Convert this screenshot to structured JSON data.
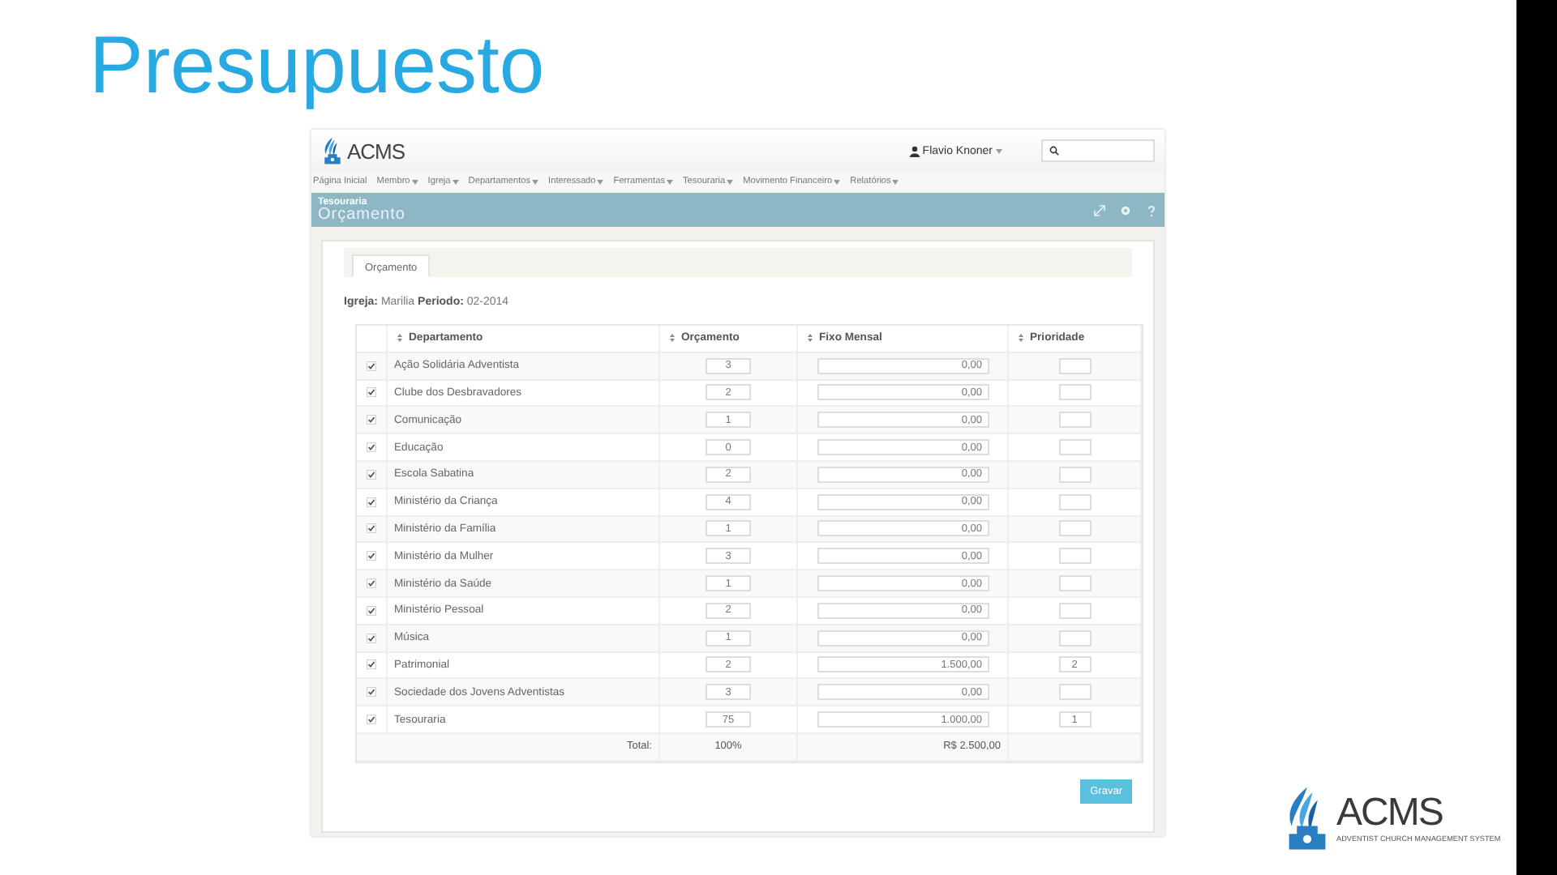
{
  "slide_title": "Presupuesto",
  "app": {
    "logo_text": "ACMS",
    "user": "Flavio Knoner",
    "nav": [
      {
        "label": "Página Inicial",
        "dropdown": false
      },
      {
        "label": "Membro",
        "dropdown": true
      },
      {
        "label": "Igreja",
        "dropdown": true
      },
      {
        "label": "Departamentos",
        "dropdown": true
      },
      {
        "label": "Interessado",
        "dropdown": true
      },
      {
        "label": "Ferramentas",
        "dropdown": true
      },
      {
        "label": "Tesouraria",
        "dropdown": true
      },
      {
        "label": "Movimento Financeiro",
        "dropdown": true
      },
      {
        "label": "Relatórios",
        "dropdown": true
      }
    ],
    "breadcrumb": "Tesouraria",
    "page_title": "Orçamento",
    "tabs": [
      {
        "label": "Orçamento",
        "selected": true
      }
    ],
    "info": "**Igreja:** Marilia   **Periodo:** 02-2014",
    "table": {
      "columns": [
        "Departamento",
        "Orçamento",
        "Fixo Mensal",
        "Prioridade"
      ],
      "rows": [
        {
          "checked": true,
          "departamento": "Ação Solidária Adventista",
          "orcamento": "3",
          "fixo": "0,00"
        },
        {
          "checked": true,
          "departamento": "Clube dos Desbravadores",
          "orcamento": "2",
          "fixo": "0,00"
        },
        {
          "checked": true,
          "departamento": "Comunicação",
          "orcamento": "1",
          "fixo": "0,00"
        },
        {
          "checked": true,
          "departamento": "Educação",
          "orcamento": "0",
          "fixo": "0,00"
        },
        {
          "checked": true,
          "departamento": "Escola Sabatina",
          "orcamento": "2",
          "fixo": "0,00"
        },
        {
          "checked": true,
          "departamento": "Ministério da Criança",
          "orcamento": "4",
          "fixo": "0,00"
        },
        {
          "checked": true,
          "departamento": "Ministério da Família",
          "orcamento": "1",
          "fixo": "0,00"
        },
        {
          "checked": true,
          "departamento": "Ministério da Mulher",
          "orcamento": "3",
          "fixo": "0,00"
        },
        {
          "checked": true,
          "departamento": "Ministério da Saúde",
          "orcamento": "1",
          "fixo": "0,00"
        },
        {
          "checked": true,
          "departamento": "Ministério Pessoal",
          "orcamento": "2",
          "fixo": "0,00"
        },
        {
          "checked": true,
          "departamento": "Música",
          "orcamento": "1",
          "fixo": "0,00"
        },
        {
          "checked": true,
          "departamento": "Patrimonial",
          "orcamento": "2",
          "fixo": "1.500,00",
          "prioridade": "2"
        },
        {
          "checked": true,
          "departamento": "Sociedade dos Jovens Adventistas",
          "orcamento": "3",
          "fixo": "0,00"
        },
        {
          "checked": true,
          "departamento": "Tesouraria",
          "orcamento": "75",
          "fixo": "1.000,00",
          "prioridade": "1"
        }
      ],
      "total_label": "Total:",
      "total_orcamento": "100%",
      "total_fixo": "R$ 2.500,00"
    },
    "save_button": "Gravar"
  },
  "footer_logo": {
    "name": "ACMS",
    "tagline": "ADVENTIST CHURCH MANAGEMENT SYSTEM"
  }
}
